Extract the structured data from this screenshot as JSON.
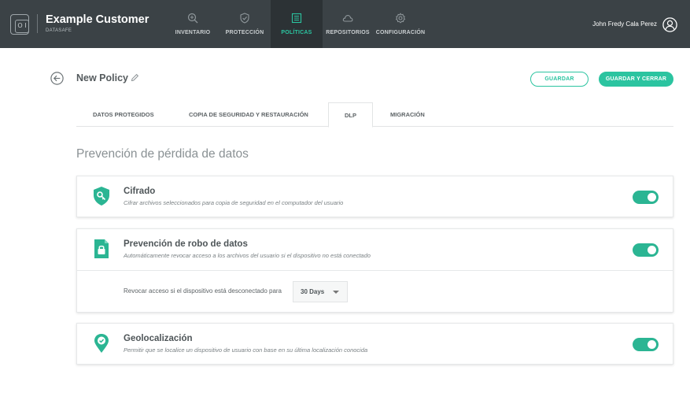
{
  "app": {
    "brand_title": "Example Customer",
    "brand_subtitle": "DATASAFE",
    "logo_glyph": "O I"
  },
  "nav": {
    "items": [
      {
        "label": "INVENTARIO",
        "icon": "search-plus-icon",
        "active": false
      },
      {
        "label": "PROTECCIÓN",
        "icon": "shield-check-icon",
        "active": false
      },
      {
        "label": "POLÍTICAS",
        "icon": "list-document-icon",
        "active": true
      },
      {
        "label": "REPOSITORIOS",
        "icon": "cloud-icon",
        "active": false
      },
      {
        "label": "CONFIGURACIÓN",
        "icon": "gear-icon",
        "active": false
      }
    ]
  },
  "user": {
    "name": "John Fredy Cala Perez",
    "avatar_icon": "user-circle-icon"
  },
  "header": {
    "policy_title": "New Policy",
    "save_label": "GUARDAR",
    "save_close_label": "GUARDAR Y CERRAR"
  },
  "tabs": [
    {
      "label": "DATOS PROTEGIDOS",
      "active": false
    },
    {
      "label": "COPIA DE SEGURIDAD Y RESTAURACIÓN",
      "active": false
    },
    {
      "label": "DLP",
      "active": true
    },
    {
      "label": "MIGRACIÓN",
      "active": false
    }
  ],
  "section_title": "Prevención de pérdida de datos",
  "cards": [
    {
      "title": "Cifrado",
      "description": "Cifrar archivos seleccionados para copia de seguridad en el computador del usuario",
      "icon": "shield-key-icon",
      "enabled": true
    },
    {
      "title": "Prevención de robo de datos",
      "description": "Automáticamente revocar acceso a los archivos del usuario si el dispositivo no está conectado",
      "icon": "file-lock-icon",
      "enabled": true,
      "sub_label": "Revocar acceso si el dispositivo está desconectado para",
      "select_value": "30 Days"
    },
    {
      "title": "Geolocalización",
      "description": "Permitir que se localice un dispositivo de usuario con base en su última localización conocida",
      "icon": "location-pin-check-icon",
      "enabled": true
    }
  ],
  "colors": {
    "accent": "#2bc4a0",
    "toggle_on": "#2bb593",
    "topbar": "#3b4246"
  }
}
